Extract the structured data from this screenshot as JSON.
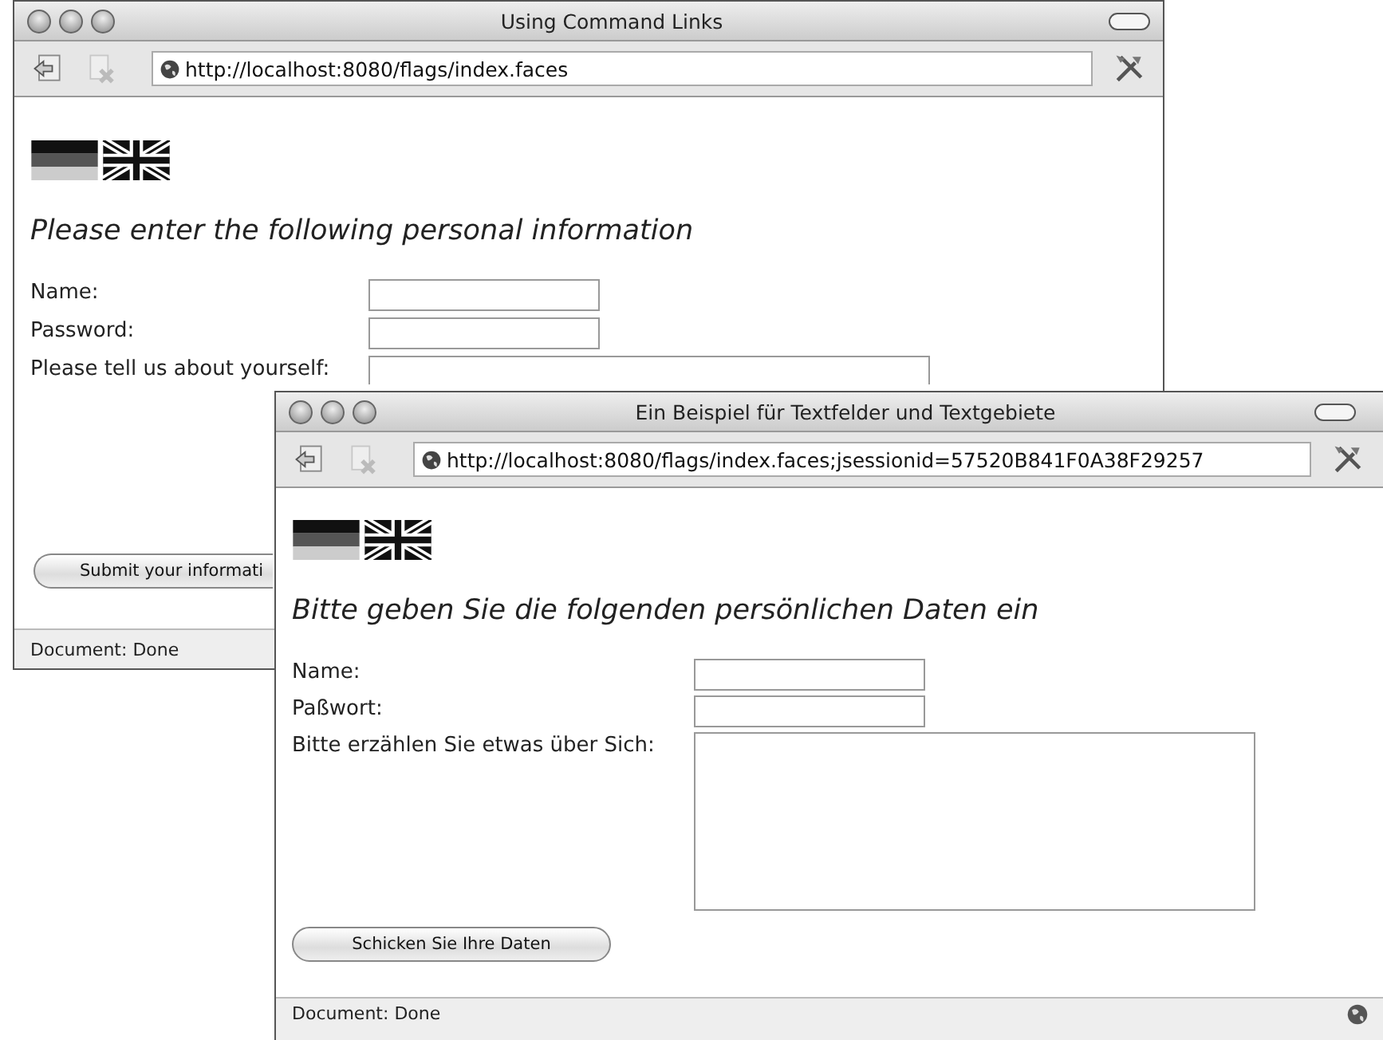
{
  "windows": [
    {
      "title": "Using Command Links",
      "url": "http://localhost:8080/flags/index.faces",
      "heading": "Please enter the following personal information",
      "fields": [
        {
          "label": "Name:",
          "kind": "text"
        },
        {
          "label": "Password:",
          "kind": "text"
        },
        {
          "label": "Please tell us about yourself:",
          "kind": "textarea"
        }
      ],
      "submit": "Submit your informati",
      "status": "Document: Done"
    },
    {
      "title": "Ein Beispiel für Textfelder und Textgebiete",
      "url": "http://localhost:8080/flags/index.faces;jsessionid=57520B841F0A38F29257",
      "heading": "Bitte geben Sie die folgenden persönlichen Daten ein",
      "fields": [
        {
          "label": "Name:",
          "kind": "text"
        },
        {
          "label": "Paßwort:",
          "kind": "text"
        },
        {
          "label": "Bitte erzählen Sie etwas über Sich:",
          "kind": "textarea"
        }
      ],
      "submit": "Schicken Sie Ihre Daten",
      "status": "Document: Done",
      "status_icon": true
    }
  ]
}
